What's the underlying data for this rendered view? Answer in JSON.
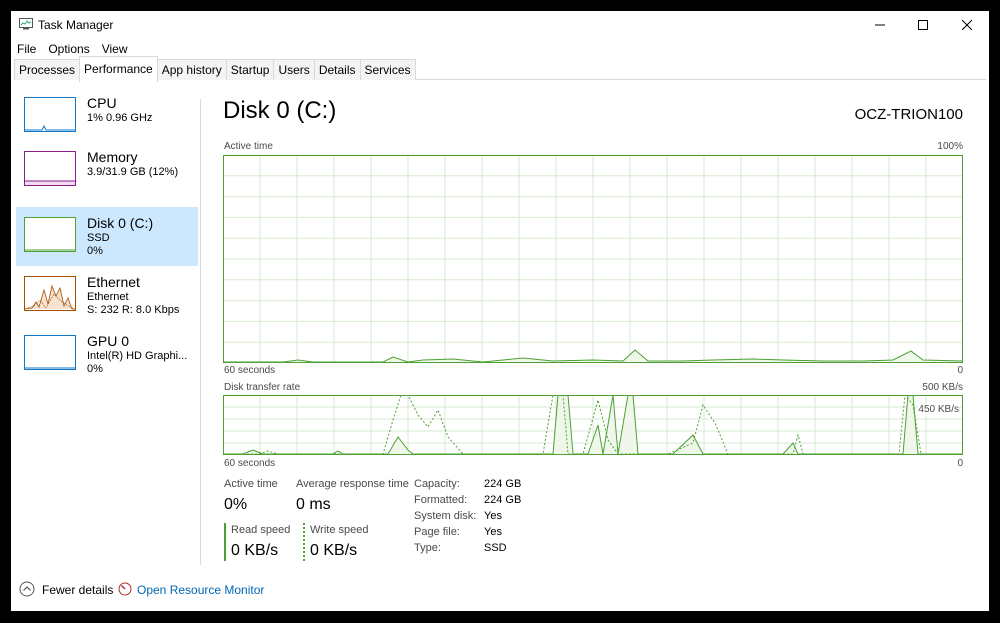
{
  "window": {
    "title": "Task Manager"
  },
  "menu": [
    "File",
    "Options",
    "View"
  ],
  "tabs": [
    "Processes",
    "Performance",
    "App history",
    "Startup",
    "Users",
    "Details",
    "Services"
  ],
  "sidebar": [
    {
      "name": "CPU",
      "line2": "1%  0.96 GHz",
      "line3": "",
      "color": "#1178c8"
    },
    {
      "name": "Memory",
      "line2": "3.9/31.9 GB (12%)",
      "line3": "",
      "color": "#8b1a8b"
    },
    {
      "name": "Disk 0 (C:)",
      "line2": "SSD",
      "line3": "0%",
      "color": "#4da033"
    },
    {
      "name": "Ethernet",
      "line2": "Ethernet",
      "line3": "S: 232  R: 8.0 Kbps",
      "color": "#a74f01"
    },
    {
      "name": "GPU 0",
      "line2": "Intel(R) HD Graphi...",
      "line3": "0%",
      "color": "#1178c8"
    }
  ],
  "main": {
    "title": "Disk 0 (C:)",
    "model": "OCZ-TRION100",
    "active_chart": {
      "label": "Active time",
      "max": "100%",
      "xleft": "60 seconds",
      "xright": "0"
    },
    "transfer_chart": {
      "label": "Disk transfer rate",
      "max": "500 KB/s",
      "mid": "450 KB/s",
      "xleft": "60 seconds",
      "xright": "0"
    },
    "stats": {
      "active_time_label": "Active time",
      "active_time_value": "0%",
      "avg_resp_label": "Average response time",
      "avg_resp_value": "0 ms",
      "read_label": "Read speed",
      "read_value": "0 KB/s",
      "write_label": "Write speed",
      "write_value": "0 KB/s"
    },
    "props": [
      {
        "label": "Capacity:",
        "value": "224 GB"
      },
      {
        "label": "Formatted:",
        "value": "224 GB"
      },
      {
        "label": "System disk:",
        "value": "Yes"
      },
      {
        "label": "Page file:",
        "value": "Yes"
      },
      {
        "label": "Type:",
        "value": "SSD"
      }
    ]
  },
  "footer": {
    "fewer_details": "Fewer details",
    "open_monitor": "Open Resource Monitor"
  },
  "colors": {
    "disk": "#4da033",
    "grid": "#d7ead0",
    "fill": "#eef7e9",
    "selected": "#cce8ff"
  }
}
